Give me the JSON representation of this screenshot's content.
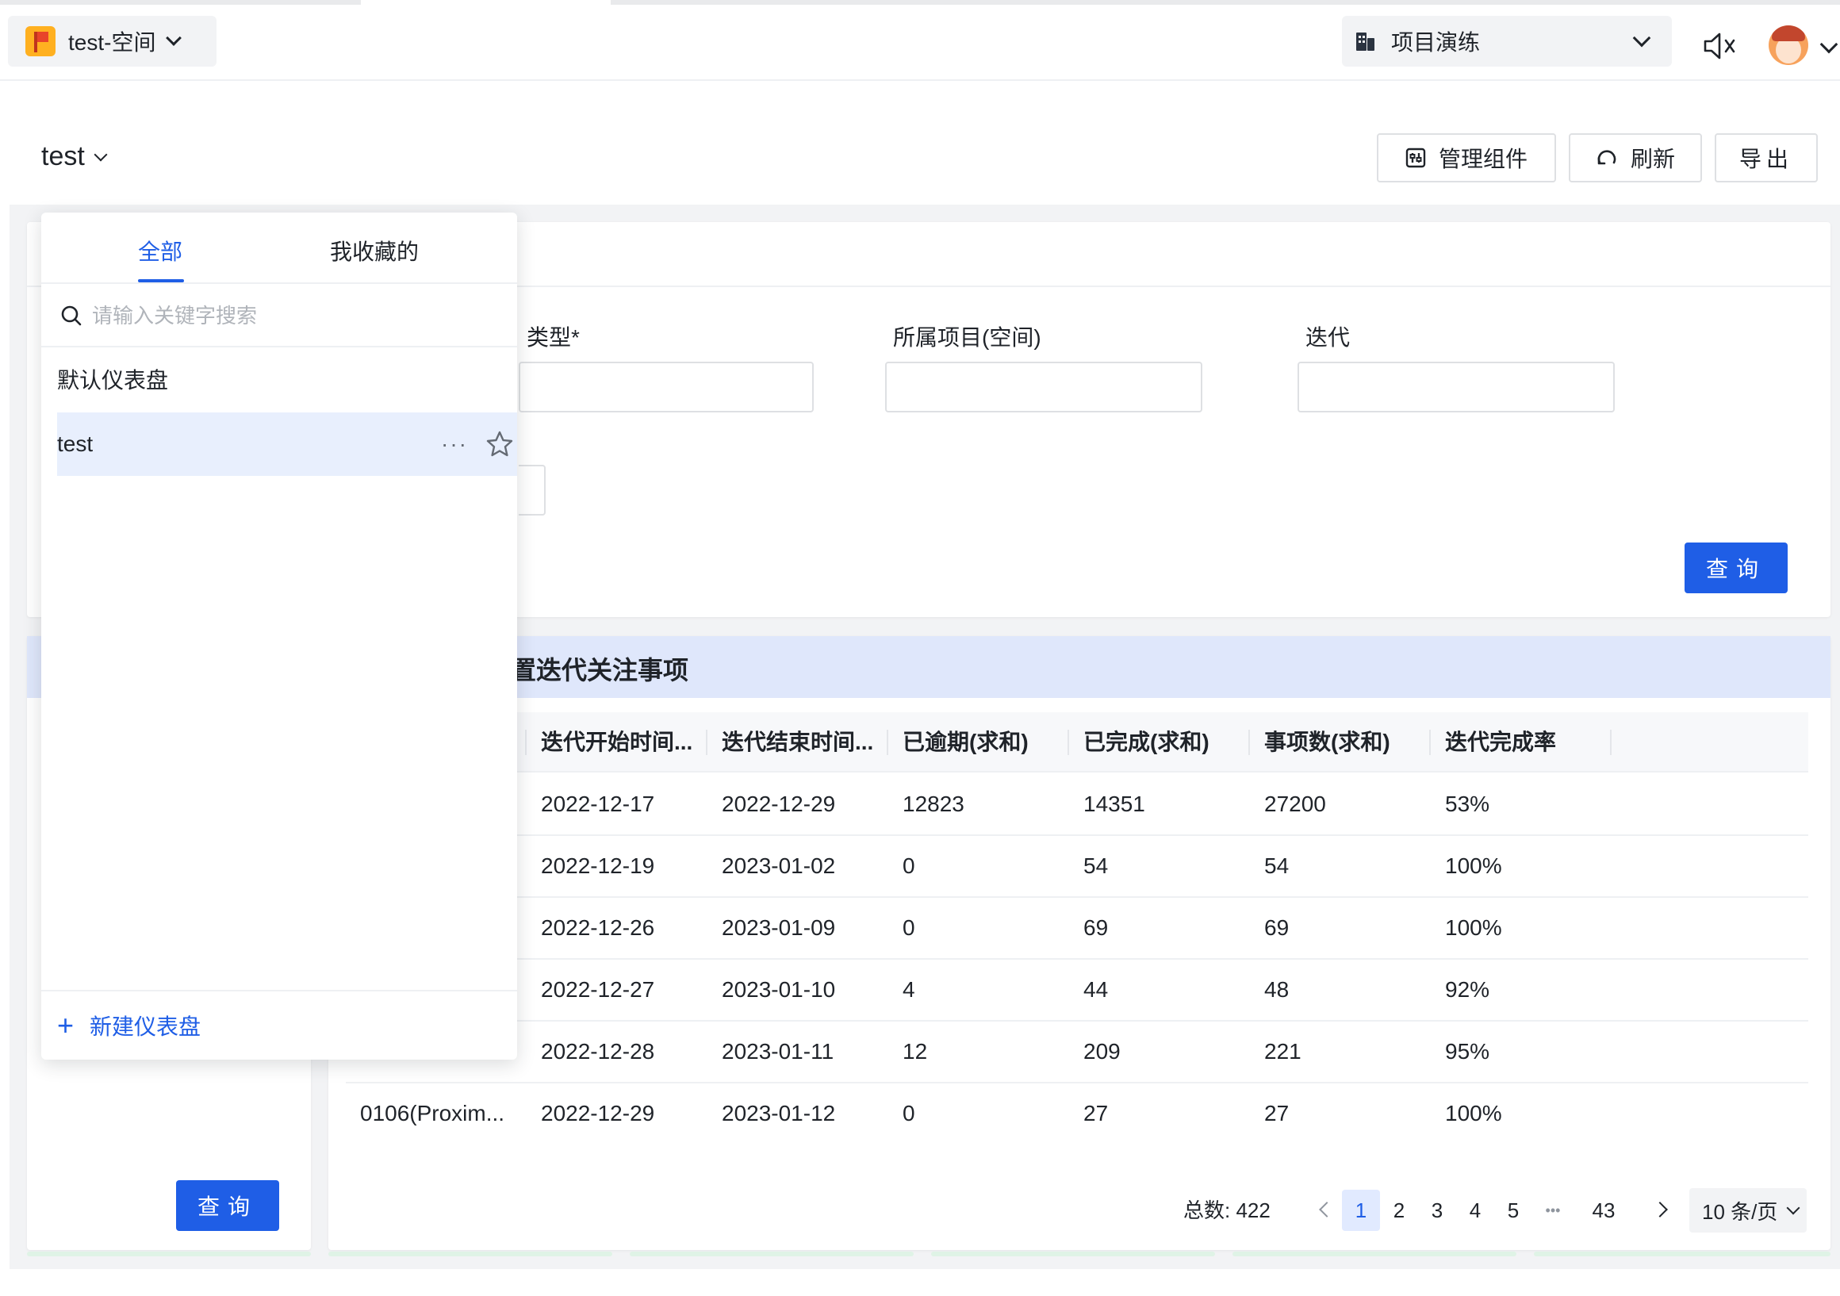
{
  "topnav": {
    "space_name": "test-空间",
    "project_name": "项目演练"
  },
  "dashboard": {
    "title": "test",
    "buttons": {
      "manage": "管理组件",
      "refresh": "刷新",
      "export": "导出"
    }
  },
  "filters": {
    "type_label": "类型*",
    "project_label": "所属项目(空间)",
    "iteration_label": "迭代",
    "query_button": "查询"
  },
  "left_card": {
    "query_button": "查询"
  },
  "table_card": {
    "title": "置迭代关注事项",
    "columns": [
      "迭代开始时间...",
      "迭代结束时间...",
      "已逾期(求和)",
      "已完成(求和)",
      "事项数(求和)",
      "迭代完成率"
    ],
    "rows": [
      {
        "name": "",
        "start": "2022-12-17",
        "end": "2022-12-29",
        "overdue": "12823",
        "done": "14351",
        "total": "27200",
        "rate": "53%"
      },
      {
        "name": "",
        "start": "2022-12-19",
        "end": "2023-01-02",
        "overdue": "0",
        "done": "54",
        "total": "54",
        "rate": "100%"
      },
      {
        "name": "",
        "start": "2022-12-26",
        "end": "2023-01-09",
        "overdue": "0",
        "done": "69",
        "total": "69",
        "rate": "100%"
      },
      {
        "name": "",
        "start": "2022-12-27",
        "end": "2023-01-10",
        "overdue": "4",
        "done": "44",
        "total": "48",
        "rate": "92%"
      },
      {
        "name": "",
        "start": "2022-12-28",
        "end": "2023-01-11",
        "overdue": "12",
        "done": "209",
        "total": "221",
        "rate": "95%"
      },
      {
        "name": "0106(Proxim...",
        "start": "2022-12-29",
        "end": "2023-01-12",
        "overdue": "0",
        "done": "27",
        "total": "27",
        "rate": "100%"
      }
    ],
    "pagination": {
      "total": "总数: 422",
      "pages": [
        "1",
        "2",
        "3",
        "4",
        "5"
      ],
      "ellipsis": "•••",
      "last_page": "43",
      "page_size": "10 条/页"
    }
  },
  "dropdown": {
    "tabs": [
      "全部",
      "我收藏的"
    ],
    "search_placeholder": "请输入关键字搜索",
    "items": [
      "默认仪表盘",
      "test"
    ],
    "more": "···",
    "new_dashboard": "新建仪表盘"
  },
  "colors": {
    "primary": "#1f5ee6",
    "table_header_band": "#dfe7fb",
    "selected_row": "#e8effd"
  }
}
